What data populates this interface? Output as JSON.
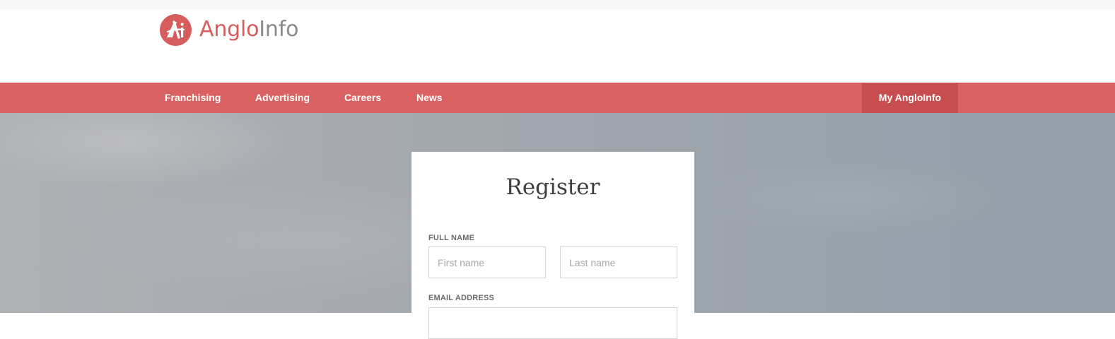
{
  "logo": {
    "text_primary": "Anglo",
    "text_secondary": "Info",
    "brand_color": "#d75d5d"
  },
  "nav": {
    "items": [
      {
        "label": "Franchising"
      },
      {
        "label": "Advertising"
      },
      {
        "label": "Careers"
      },
      {
        "label": "News"
      }
    ],
    "account_label": "My AngloInfo",
    "bar_color": "#da6262"
  },
  "register": {
    "title": "Register",
    "full_name_label": "FULL NAME",
    "first_name_placeholder": "First name",
    "last_name_placeholder": "Last name",
    "email_label": "EMAIL ADDRESS",
    "email_placeholder": ""
  }
}
